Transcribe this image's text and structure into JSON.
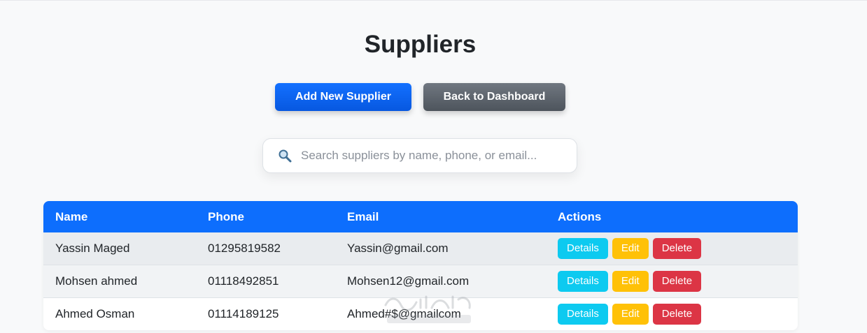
{
  "page": {
    "title": "Suppliers"
  },
  "toolbar": {
    "add_label": "Add New Supplier",
    "back_label": "Back to Dashboard"
  },
  "search": {
    "placeholder": "Search suppliers by name, phone, or email...",
    "value": "",
    "icon": "search-icon"
  },
  "table": {
    "headers": {
      "name": "Name",
      "phone": "Phone",
      "email": "Email",
      "actions": "Actions"
    },
    "rows": [
      {
        "name": "Yassin Maged",
        "phone": "01295819582",
        "email": "Yassin@gmail.com"
      },
      {
        "name": "Mohsen ahmed",
        "phone": "01118492851",
        "email": "Mohsen12@gmail.com"
      },
      {
        "name": "Ahmed Osman",
        "phone": "01114189125",
        "email": "Ahmed#$@gmailcom"
      }
    ],
    "actions": {
      "details_label": "Details",
      "edit_label": "Edit",
      "delete_label": "Delete"
    }
  },
  "watermark": {
    "text_latin": "mostaql.com"
  },
  "colors": {
    "primary": "#0d6efd",
    "secondary": "#6c757d",
    "details": "#0dcaf0",
    "edit": "#ffc107",
    "delete": "#dc3545",
    "background": "#f8f9fa"
  }
}
